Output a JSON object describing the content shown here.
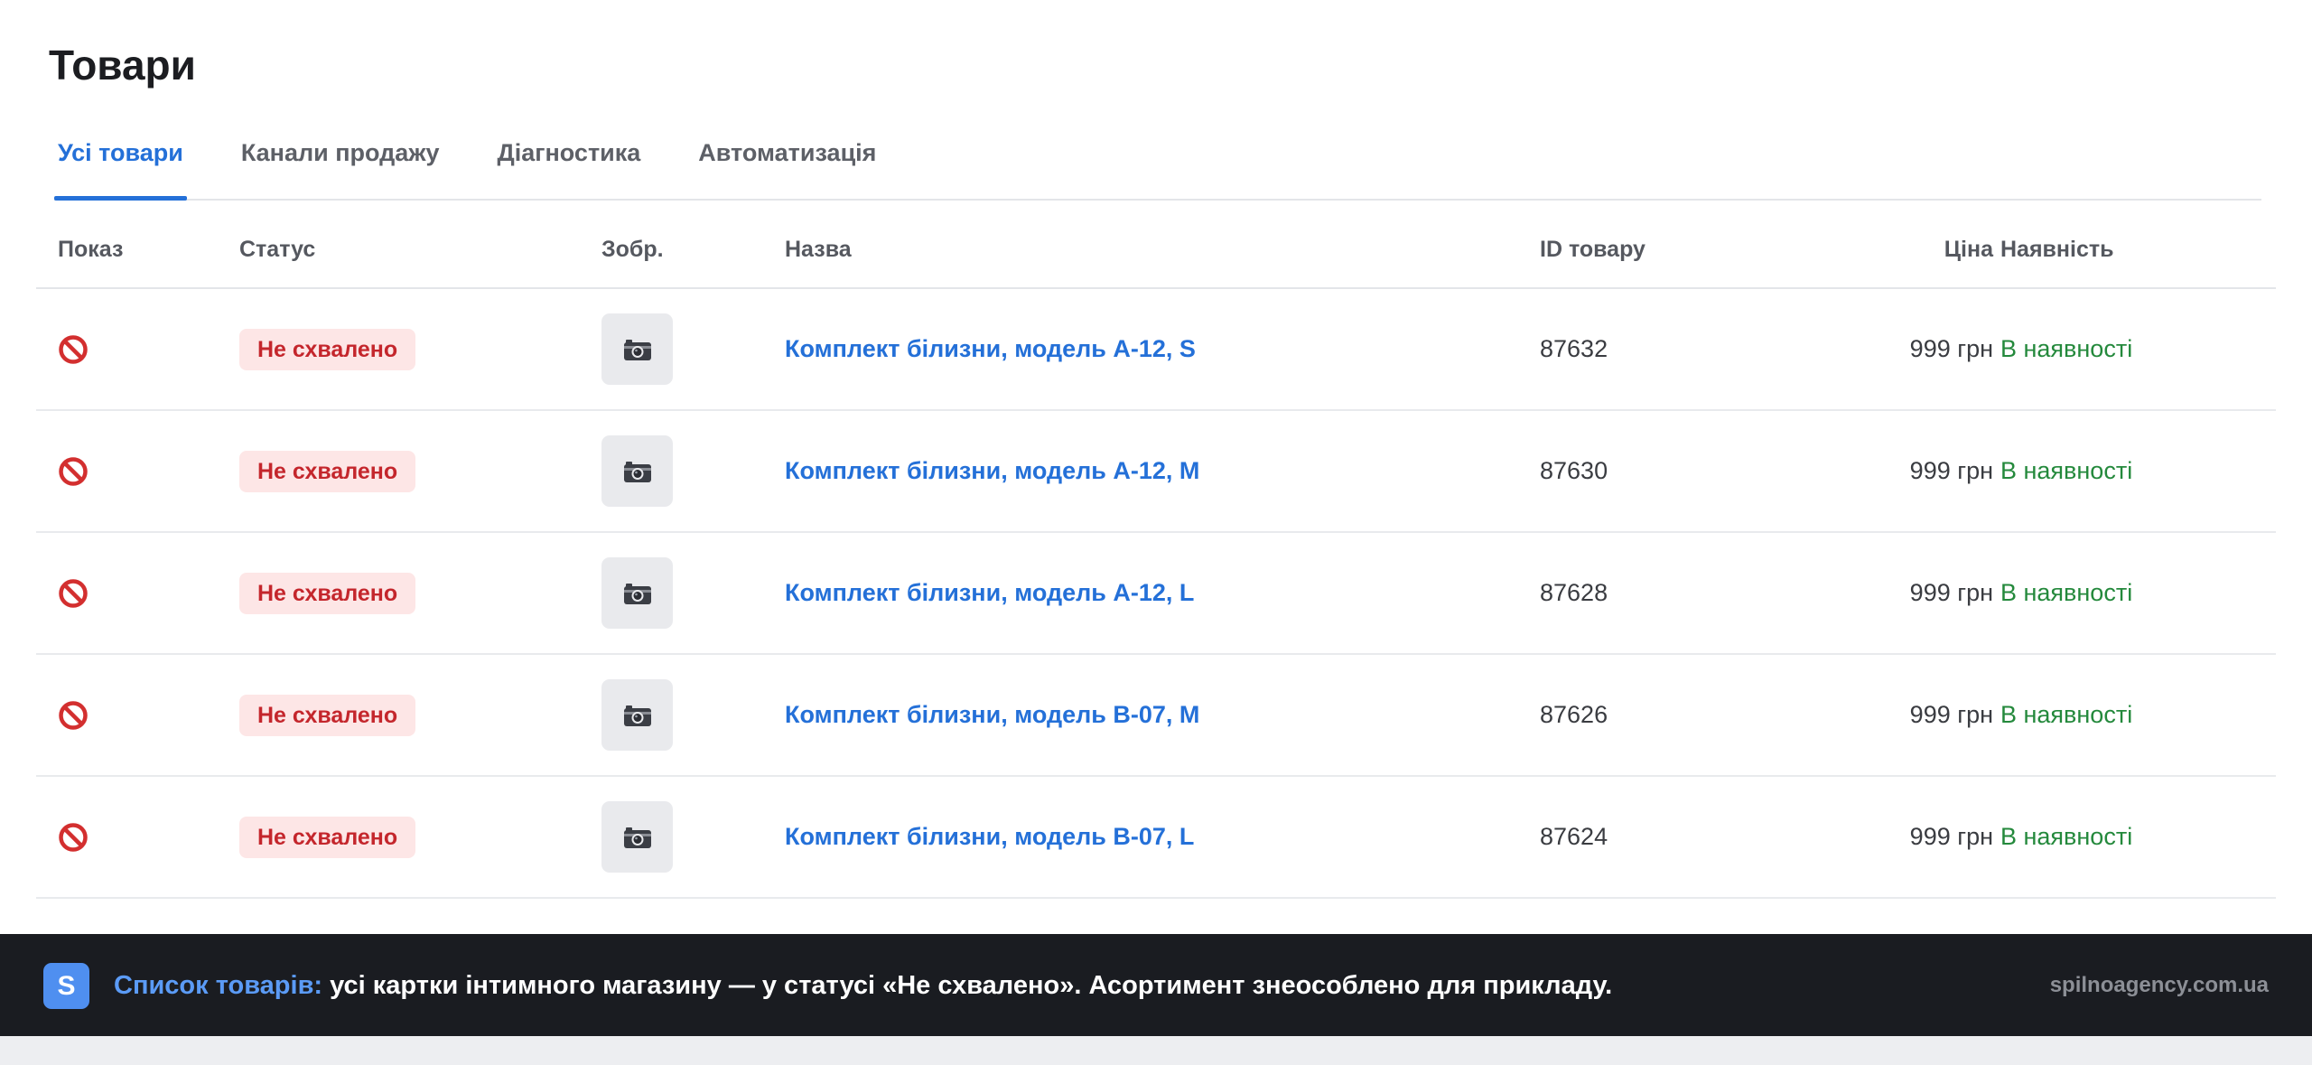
{
  "page": {
    "title": "Товари"
  },
  "tabs": [
    {
      "label": "Усі товари",
      "active": true
    },
    {
      "label": "Канали продажу",
      "active": false
    },
    {
      "label": "Діагностика",
      "active": false
    },
    {
      "label": "Автоматизація",
      "active": false
    }
  ],
  "table": {
    "headers": {
      "show": "Показ",
      "status": "Статус",
      "image": "Зобр.",
      "name": "Назва",
      "id": "ID товару",
      "price": "Ціна",
      "stock": "Наявність"
    },
    "rows": [
      {
        "show_icon": "prohibited-icon",
        "status": "Не схвалено",
        "image_icon": "camera-icon",
        "name": "Комплект білизни, модель A-12, S",
        "id": "87632",
        "price": "999 грн",
        "stock": "В наявності"
      },
      {
        "show_icon": "prohibited-icon",
        "status": "Не схвалено",
        "image_icon": "camera-icon",
        "name": "Комплект білизни, модель A-12, M",
        "id": "87630",
        "price": "999 грн",
        "stock": "В наявності"
      },
      {
        "show_icon": "prohibited-icon",
        "status": "Не схвалено",
        "image_icon": "camera-icon",
        "name": "Комплект білизни, модель A-12, L",
        "id": "87628",
        "price": "999 грн",
        "stock": "В наявності"
      },
      {
        "show_icon": "prohibited-icon",
        "status": "Не схвалено",
        "image_icon": "camera-icon",
        "name": "Комплект білизни, модель B-07, M",
        "id": "87626",
        "price": "999 грн",
        "stock": "В наявності"
      },
      {
        "show_icon": "prohibited-icon",
        "status": "Не схвалено",
        "image_icon": "camera-icon",
        "name": "Комплект білизни, модель B-07, L",
        "id": "87624",
        "price": "999 грн",
        "stock": "В наявності"
      }
    ]
  },
  "footer": {
    "logo_letter": "S",
    "label": "Список товарів:",
    "text": " усі картки інтимного магазину — у статусі «Не схвалено». Асортимент знеособлено для прикладу.",
    "site": "spilnoagency.com.ua"
  },
  "colors": {
    "accent": "#2470d8",
    "status_badge_bg": "#fde6e6",
    "status_badge_text": "#c4262c",
    "in_stock": "#24893c",
    "footer_bg": "#1a1c21",
    "footer_label": "#5b9bf6"
  }
}
